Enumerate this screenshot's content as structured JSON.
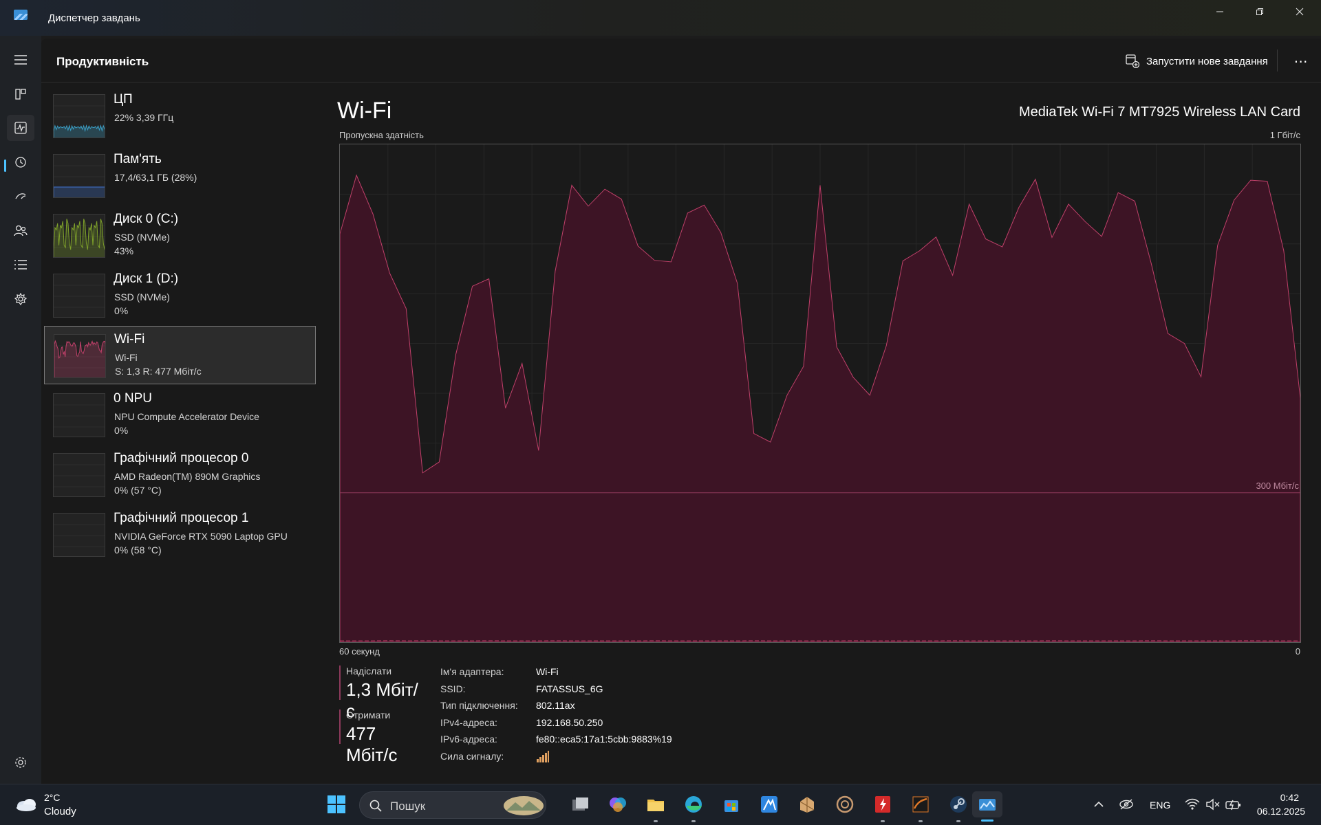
{
  "window": {
    "title": "Диспетчер завдань",
    "controls": [
      "minimize",
      "maximize",
      "close"
    ]
  },
  "header": {
    "page_title": "Продуктивність",
    "run_task_label": "Запустити нове завдання",
    "more_label": "⋯"
  },
  "rail": {
    "icons": [
      "menu-icon",
      "processes-icon",
      "performance-icon",
      "app-history-icon",
      "startup-icon",
      "users-icon",
      "details-icon",
      "services-icon",
      "settings-icon"
    ],
    "active": "performance-icon"
  },
  "devices": [
    {
      "name": "ЦП",
      "line1": "22%  3,39 ГГц",
      "line2": "",
      "color": "#3aa0c8",
      "kind": "cpu"
    },
    {
      "name": "Пам'ять",
      "line1": "17,4/63,1 ГБ (28%)",
      "line2": "",
      "color": "#3b6fd0",
      "kind": "memory",
      "usage": 0.28
    },
    {
      "name": "Диск 0 (C:)",
      "line1": "SSD (NVMe)",
      "line2": "43%",
      "color": "#7fa22a",
      "kind": "disk",
      "usage": 0.43
    },
    {
      "name": "Диск 1 (D:)",
      "line1": "SSD (NVMe)",
      "line2": "0%",
      "color": "#7fa22a",
      "kind": "disk",
      "usage": 0
    },
    {
      "name": "Wi-Fi",
      "line1": "Wi-Fi",
      "line2": "S: 1,3  R: 477 Мбіт/с",
      "color": "#c0406a",
      "kind": "wifi",
      "selected": true
    },
    {
      "name": "0 NPU",
      "line1": "NPU Compute Accelerator Device",
      "line2": "0%",
      "color": "#3aa0c8",
      "kind": "npu",
      "usage": 0
    },
    {
      "name": "Графічний процесор 0",
      "line1": "AMD Radeon(TM) 890M Graphics",
      "line2": "0%  (57 °C)",
      "color": "#3aa0c8",
      "kind": "gpu",
      "usage": 0
    },
    {
      "name": "Графічний процесор 1",
      "line1": "NVIDIA GeForce RTX 5090 Laptop GPU",
      "line2": "0%  (58 °C)",
      "color": "#3aa0c8",
      "kind": "gpu",
      "usage": 0
    }
  ],
  "graph": {
    "title": "Wi-Fi",
    "adapter": "MediaTek Wi-Fi 7 MT7925 Wireless LAN Card",
    "caption": "Пропускна здатність",
    "max_label": "1 Гбіт/с",
    "mid_label": "300 Мбіт/с",
    "left_bottom": "60 секунд",
    "right_bottom": "0"
  },
  "chart_data": {
    "type": "area",
    "title": "Wi-Fi",
    "ylabel": "Пропускна здатність",
    "ylim": [
      0,
      1000
    ],
    "y_unit": "Мбіт/с",
    "x_range_seconds": [
      60,
      0
    ],
    "series": [
      {
        "name": "Отримати",
        "color": "#c0406a",
        "values": [
          820,
          938,
          860,
          742,
          670,
          340,
          362,
          578,
          715,
          730,
          470,
          560,
          385,
          745,
          918,
          876,
          910,
          890,
          796,
          767,
          764,
          862,
          878,
          823,
          721,
          419,
          402,
          496,
          554,
          918,
          593,
          532,
          496,
          596,
          766,
          786,
          814,
          737,
          880,
          810,
          794,
          873,
          930,
          813,
          880,
          845,
          815,
          903,
          886,
          760,
          620,
          600,
          533,
          797,
          888,
          928,
          926,
          786,
          490
        ]
      },
      {
        "name": "Надіслати",
        "color": "#c0406a",
        "values": [
          1.3,
          1.3,
          1.2,
          1.5,
          1.3,
          1.4,
          1.2,
          1.3,
          1.3,
          1.4,
          1.3,
          1.2,
          1.3,
          1.4,
          1.3,
          1.2,
          1.3,
          1.3,
          1.2,
          1.4,
          1.3,
          1.3,
          1.2,
          1.3,
          1.3,
          1.4,
          1.3,
          1.2,
          1.3,
          1.3,
          1.3,
          1.4,
          1.3,
          1.2,
          1.3,
          1.3,
          1.3,
          1.4,
          1.3,
          1.2,
          1.3,
          1.3,
          1.3,
          1.4,
          1.3,
          1.2,
          1.3,
          1.3,
          1.3,
          1.4,
          1.3,
          1.2,
          1.3,
          1.3,
          1.3,
          1.4,
          1.3,
          1.2,
          1.3
        ]
      }
    ],
    "reference_lines": [
      300
    ],
    "grid": true
  },
  "stats": {
    "sent_label": "Надіслати",
    "sent_value": "1,3 Мбіт/с",
    "recv_label": "Отримати",
    "recv_value": "477 Мбіт/с"
  },
  "properties": [
    {
      "key": "Ім'я адаптера:",
      "value": "Wi-Fi"
    },
    {
      "key": "SSID:",
      "value": "FATASSUS_6G"
    },
    {
      "key": "Тип підключення:",
      "value": "802.11ax"
    },
    {
      "key": "IPv4-адреса:",
      "value": "192.168.50.250"
    },
    {
      "key": "IPv6-адреса:",
      "value": "fe80::eca5:17a1:5cbb:9883%19"
    },
    {
      "key": "Сила сигналу:",
      "value": ""
    }
  ],
  "taskbar": {
    "weather_temp": "2°C",
    "weather_desc": "Cloudy",
    "search_placeholder": "Пошук",
    "language": "ENG",
    "time": "0:42",
    "date": "06.12.2025",
    "apps": [
      "start-icon",
      "task-view-icon",
      "copilot-m365-icon",
      "file-explorer-icon",
      "edge-icon",
      "store-icon",
      "app-icon-blue",
      "app-icon-sketch",
      "app-icon-brain",
      "app-icon-red",
      "app-icon-orange",
      "steam-icon",
      "task-manager-icon"
    ]
  }
}
